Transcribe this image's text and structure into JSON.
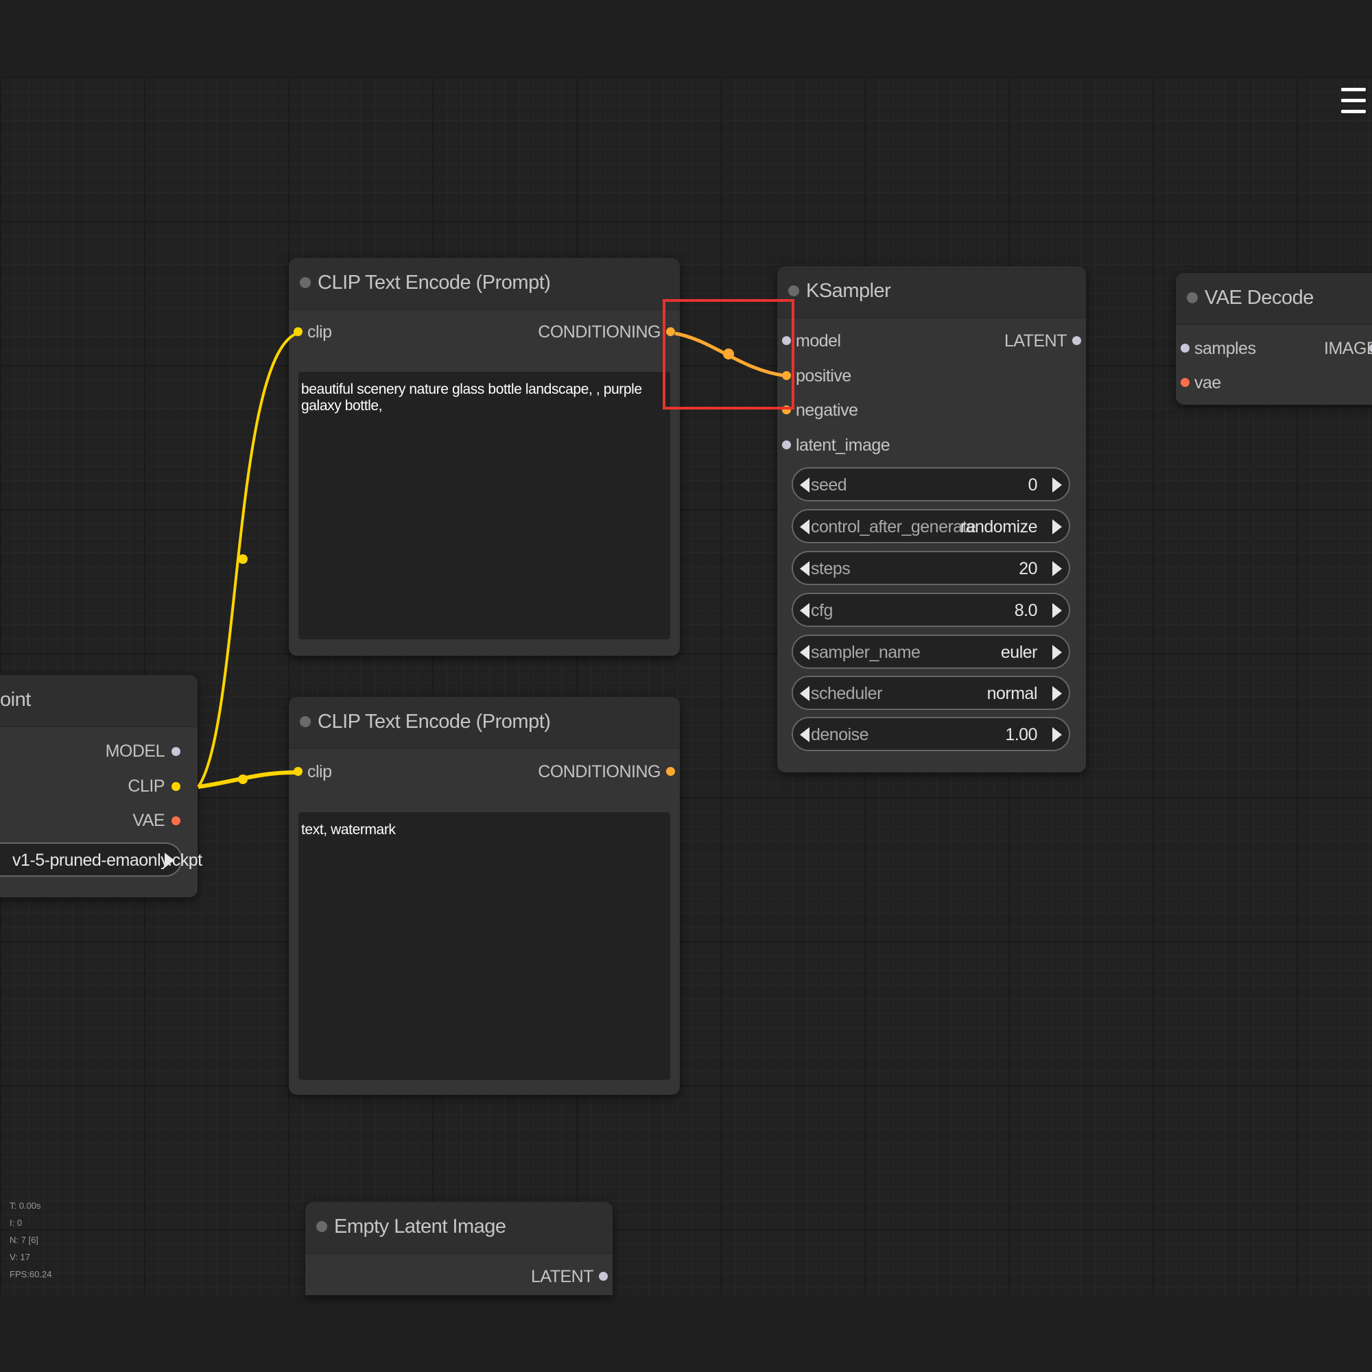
{
  "menu": {
    "icon": "hamburger-menu-icon"
  },
  "nodes": {
    "clip_top": {
      "title": "CLIP Text Encode (Prompt)",
      "input": "clip",
      "output": "CONDITIONING",
      "text": "beautiful scenery nature glass bottle landscape, , purple galaxy bottle,"
    },
    "clip_bottom": {
      "title": "CLIP Text Encode (Prompt)",
      "input": "clip",
      "output": "CONDITIONING",
      "text": "text, watermark"
    },
    "checkpoint": {
      "title": "oint",
      "outputs": [
        "MODEL",
        "CLIP",
        "VAE"
      ],
      "ckpt_name": "v1-5-pruned-emaonly.ckpt"
    },
    "ksampler": {
      "title": "KSampler",
      "inputs": [
        "model",
        "positive",
        "negative",
        "latent_image"
      ],
      "output": "LATENT",
      "widgets": [
        {
          "label": "seed",
          "value": "0"
        },
        {
          "label": "control_after_generate",
          "value": "randomize"
        },
        {
          "label": "steps",
          "value": "20"
        },
        {
          "label": "cfg",
          "value": "8.0"
        },
        {
          "label": "sampler_name",
          "value": "euler"
        },
        {
          "label": "scheduler",
          "value": "normal"
        },
        {
          "label": "denoise",
          "value": "1.00"
        }
      ]
    },
    "vae_decode": {
      "title": "VAE Decode",
      "inputs": [
        "samples",
        "vae"
      ],
      "output": "IMAGE"
    },
    "empty_latent": {
      "title": "Empty Latent Image",
      "output": "LATENT"
    }
  },
  "stats": [
    "T: 0.00s",
    "I: 0",
    "N: 7 [6]",
    "V: 17",
    "FPS:60.24"
  ],
  "colors": {
    "clip_link": "#ffd500",
    "conditioning_link": "#ffa931",
    "highlight": "#e8332e",
    "background": "#212121",
    "node": "#353535"
  }
}
